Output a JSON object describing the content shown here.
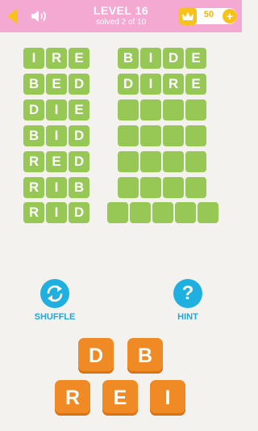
{
  "header": {
    "level": "LEVEL 16",
    "progress": "solved 2 of 10",
    "coins": "50",
    "back_icon": "back-arrow-icon",
    "sound_icon": "speaker-icon",
    "coin_icon": "crown-icon",
    "add_icon": "plus-icon"
  },
  "hint_words": [
    [
      "I",
      "R",
      "E"
    ],
    [
      "B",
      "E",
      "D"
    ],
    [
      "D",
      "I",
      "E"
    ],
    [
      "B",
      "I",
      "D"
    ],
    [
      "R",
      "E",
      "D"
    ],
    [
      "R",
      "I",
      "B"
    ],
    [
      "R",
      "I",
      "D"
    ]
  ],
  "answers": [
    {
      "letters": [
        "B",
        "I",
        "D",
        "E"
      ],
      "solved": true
    },
    {
      "letters": [
        "D",
        "I",
        "R",
        "E"
      ],
      "solved": true
    },
    {
      "letters": [
        "",
        "",
        "",
        ""
      ],
      "solved": false
    },
    {
      "letters": [
        "",
        "",
        "",
        ""
      ],
      "solved": false
    },
    {
      "letters": [
        "",
        "",
        "",
        ""
      ],
      "solved": false
    },
    {
      "letters": [
        "",
        "",
        "",
        ""
      ],
      "solved": false
    },
    {
      "letters": [
        "",
        "",
        "",
        "",
        ""
      ],
      "solved": false
    }
  ],
  "actions": {
    "shuffle_label": "SHUFFLE",
    "hint_label": "HINT",
    "hint_symbol": "?"
  },
  "letter_tiles": {
    "row1": [
      "D",
      "B"
    ],
    "row2": [
      "R",
      "E",
      "I"
    ]
  },
  "colors": {
    "header": "#f4a9d3",
    "tile_green": "#97c855",
    "accent_blue": "#1fb0e0",
    "tile_orange": "#f08a24",
    "coin_gold": "#f6c21b"
  }
}
